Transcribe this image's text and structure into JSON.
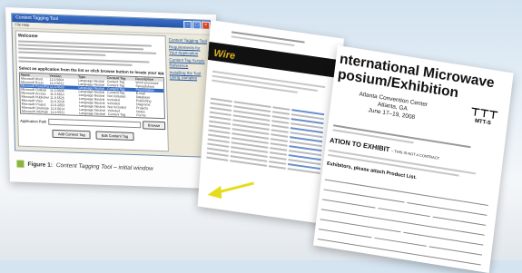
{
  "doc1": {
    "window_title": "Content Tagging Tool",
    "menu": "File  Help",
    "welcome": "Welcome",
    "select_label": "Select an application from the list or click browse button to locate your application",
    "list_headers": [
      "Name",
      "Version",
      "Type",
      "Content Tag",
      "Description"
    ],
    "list_rows": [
      [
        "Microsoft Word",
        "11.0.5604",
        "Language Neutral",
        "Content Tag",
        "Word processor"
      ],
      [
        "Microsoft Excel",
        "11.0.5612",
        "Language Neutral",
        "Content Tag",
        "Spreadsheet"
      ],
      [
        "Microsoft PowerPoint",
        "11.0.5529",
        "Language Neutral",
        "Content Tag",
        "Presentation"
      ],
      [
        "Microsoft Outlook",
        "11.0.5608",
        "Language Neutral",
        "Content Tag",
        "E-mail"
      ],
      [
        "Microsoft Access",
        "11.0.5614",
        "Language Neutral",
        "Not Included",
        "Database"
      ],
      [
        "Microsoft Publisher",
        "11.0.5525",
        "Language Neutral",
        "Included",
        "Publishing"
      ],
      [
        "Microsoft Visio",
        "11.0.3216",
        "Language Neutral",
        "Included",
        "Diagrams"
      ],
      [
        "Microsoft Project",
        "11.0.2003",
        "Language Neutral",
        "Not Included",
        "Projects"
      ],
      [
        "Microsoft OneNote",
        "11.0.5614",
        "Language Neutral",
        "Included",
        "Notes"
      ],
      [
        "Microsoft InfoPath",
        "11.0.5531",
        "Language Neutral",
        "Content Tag",
        "Forms"
      ]
    ],
    "path_label": "Application Path",
    "browse": "Browse",
    "add_button": "Add Content Tag",
    "edit_button": "Edit Content Tag",
    "sidebar_links": [
      "Content Tagging Tool",
      "Requirements for Your Application",
      "Content Tag Scripts Reference",
      "Installing the Tool Using Samples"
    ],
    "figure_label": "Figure 1:",
    "figure_caption": "Content Tagging Tool – initial window"
  },
  "doc2": {
    "logo": "Wire"
  },
  "doc3": {
    "title_line1": "nternational Microwave",
    "title_line2": "posium/Exhibition",
    "venue": [
      "Atlanta Convention Center",
      "Atlanta, GA",
      "June 17–19, 2008"
    ],
    "logo_text": "MTT-S",
    "invitation": "ATION TO EXHIBIT",
    "invitation_note": "– THIS IS NOT A CONTRACT",
    "product_note": "Exhibitors, please attach Product List."
  },
  "colors": {
    "background_top": "#d3e3f0",
    "figure_square": "#8bb63d",
    "arrow": "#e6dc1e",
    "logo_gold": "#d9b024"
  }
}
